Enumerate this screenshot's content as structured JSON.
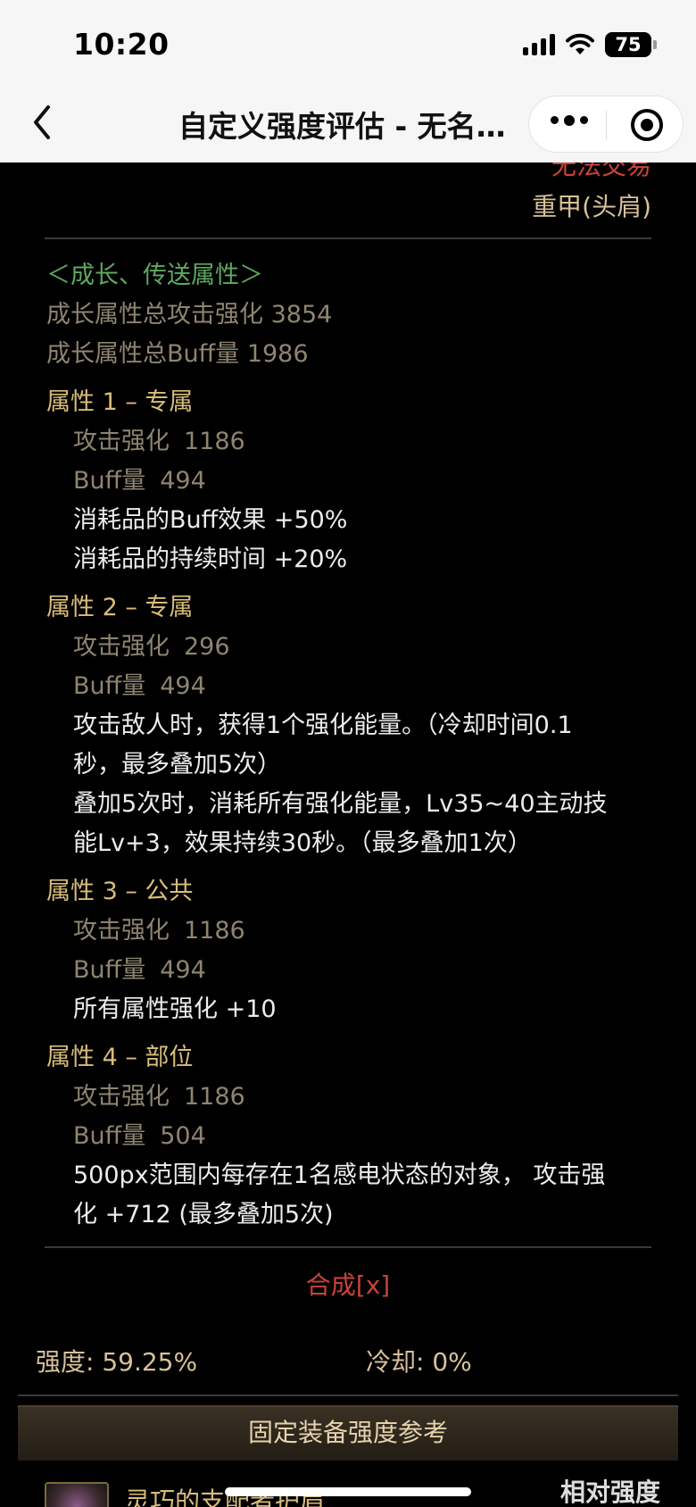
{
  "status_bar": {
    "time": "10:20",
    "battery": "75"
  },
  "nav": {
    "title": "自定义强度评估 - 无名…"
  },
  "item": {
    "trade": "无法交易",
    "armor_type": "重甲(头肩)",
    "growth_header": "＜成长、传送属性＞",
    "growth_attack": "成长属性总攻击强化 3854",
    "growth_buff": "成长属性总Buff量 1986",
    "attrs": [
      {
        "title": "属性 1 – 专属",
        "attack_label": "攻击强化",
        "attack_value": "1186",
        "buff_label": "Buff量",
        "buff_value": "494",
        "effects": [
          "消耗品的Buff效果 +50%",
          "消耗品的持续时间 +20%"
        ]
      },
      {
        "title": "属性 2 – 专属",
        "attack_label": "攻击强化",
        "attack_value": "296",
        "buff_label": "Buff量",
        "buff_value": "494",
        "effects": [
          "攻击敌人时，获得1个强化能量。（冷却时间0.1",
          "秒，最多叠加5次）",
          "叠加5次时，消耗所有强化能量，Lv35~40主动技",
          "能Lv+3，效果持续30秒。（最多叠加1次）"
        ]
      },
      {
        "title": "属性 3 – 公共",
        "attack_label": "攻击强化",
        "attack_value": "1186",
        "buff_label": "Buff量",
        "buff_value": "494",
        "effects": [
          "所有属性强化 +10"
        ]
      },
      {
        "title": "属性 4 – 部位",
        "attack_label": "攻击强化",
        "attack_value": "1186",
        "buff_label": "Buff量",
        "buff_value": "504",
        "effects": [
          "500px范围内每存在1名感电状态的对象， 攻击强",
          "化 +712 (最多叠加5次)"
        ]
      }
    ],
    "compose": "合成[x]"
  },
  "stats": {
    "strength": "强度: 59.25%",
    "cooldown": "冷却: 0%"
  },
  "reference": {
    "title": "固定装备强度参考",
    "item_name": "灵巧的支配者护肩",
    "relative_label": "相对强度"
  }
}
